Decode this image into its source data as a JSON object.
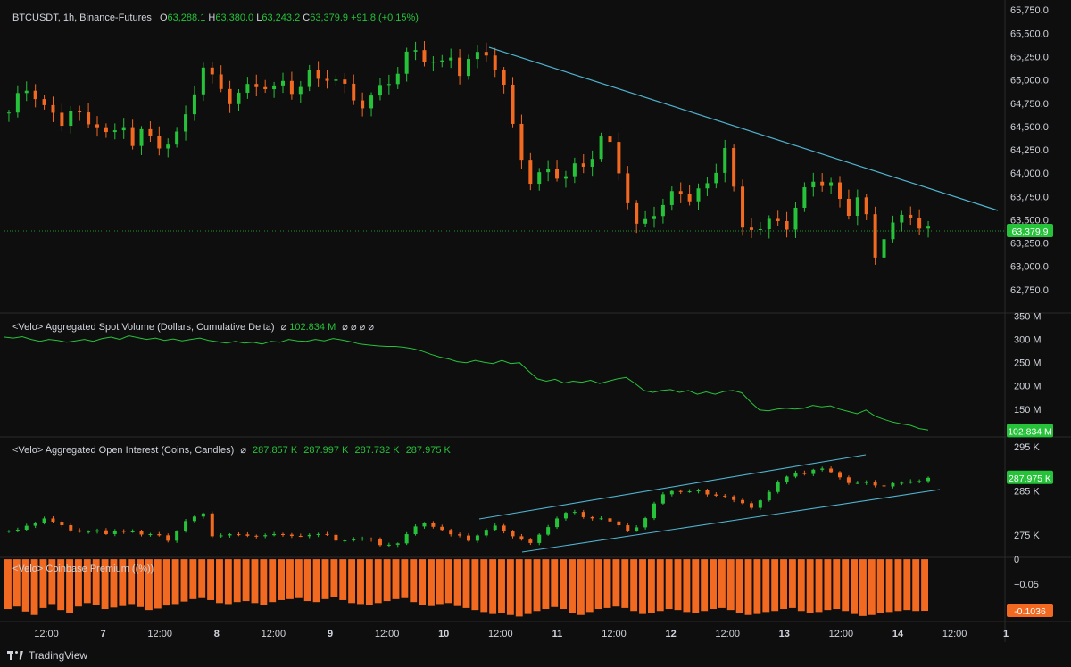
{
  "main": {
    "symbol": "BTCUSDT, 1h, Binance-Futures",
    "o_label": "O",
    "o_value": "63,288.1",
    "h_label": "H",
    "h_value": "63,380.0",
    "l_label": "L",
    "l_value": "63,243.2",
    "c_label": "C",
    "c_value": "63,379.9",
    "change": "+91.8 (+0.15%)",
    "last_price_tag": "63,379.9"
  },
  "volume_pane": {
    "title": "<Velo> Aggregated Spot Volume (Dollars, Cumulative Delta)",
    "settings_glyph": "⌀",
    "value": "102.834 M",
    "extra_glyphs": "⌀ ⌀ ⌀ ⌀",
    "tag": "102.834 M"
  },
  "oi_pane": {
    "title": "<Velo> Aggregated Open Interest (Coins, Candles)",
    "settings_glyph": "⌀",
    "values": [
      "287.857 K",
      "287.997 K",
      "287.732 K",
      "287.975 K"
    ],
    "tag": "287.975 K"
  },
  "premium_pane": {
    "title": "<Velo> Coinbase Premium ((%))",
    "tag": "-0.1036"
  },
  "footer": {
    "brand": "TradingView"
  },
  "colors": {
    "up": "#26c23a",
    "down": "#f26a21",
    "trend": "#4fb3cf",
    "line": "#26c23a",
    "bg": "#0e0e0e"
  },
  "chart_data": [
    {
      "type": "candlestick",
      "title": "BTCUSDT, 1h, Binance-Futures",
      "x_tick_labels": [
        "12:00",
        "7",
        "12:00",
        "8",
        "12:00",
        "9",
        "12:00",
        "10",
        "12:00",
        "11",
        "12:00",
        "12",
        "12:00",
        "13",
        "12:00",
        "14",
        "12:00",
        "1"
      ],
      "y_tick_labels": [
        "65,750.0",
        "65,500.0",
        "65,250.0",
        "65,000.0",
        "64,750.0",
        "64,500.0",
        "64,250.0",
        "64,000.0",
        "63,750.0",
        "63,500.0",
        "63,250.0",
        "63,000.0",
        "62,750.0"
      ],
      "ylim": [
        62500,
        65800
      ],
      "close_path_x": [
        0,
        10,
        20,
        30,
        40,
        50,
        60,
        70,
        80,
        90,
        100,
        110,
        120,
        130,
        140,
        150,
        160,
        170,
        180,
        190,
        200,
        210,
        220,
        230,
        240,
        250,
        260,
        270,
        280,
        290,
        300,
        310,
        320,
        330,
        340,
        350,
        360,
        370,
        380,
        390,
        400,
        410,
        420,
        430,
        440,
        450,
        460,
        470,
        480,
        490,
        500,
        510,
        520,
        530,
        540,
        550,
        560,
        570,
        580,
        590,
        600,
        610,
        620,
        630,
        640,
        650,
        660,
        670,
        680,
        690,
        700,
        710,
        720,
        730,
        740,
        750,
        760,
        770,
        780,
        790,
        800,
        810,
        820,
        830,
        840,
        850,
        860,
        870,
        880,
        890,
        900,
        910,
        920,
        930,
        940,
        950,
        960,
        970,
        980,
        990,
        1000,
        1010,
        1020,
        1030,
        1040
      ],
      "close_path_y": [
        64650,
        64800,
        64900,
        64850,
        64700,
        64600,
        64550,
        64700,
        64600,
        64500,
        64550,
        64450,
        64400,
        64500,
        64350,
        64450,
        64350,
        64300,
        64350,
        64400,
        64600,
        64900,
        65150,
        65000,
        64900,
        64800,
        64850,
        64900,
        64950,
        64950,
        64900,
        64950,
        64900,
        64950,
        65050,
        65000,
        65050,
        65000,
        64900,
        64800,
        64750,
        64800,
        64900,
        65000,
        65100,
        65250,
        65300,
        65250,
        65200,
        65150,
        65250,
        65100,
        65200,
        65250,
        65300,
        65150,
        64900,
        64500,
        64200,
        63900,
        63950,
        64050,
        64000,
        63950,
        64050,
        64100,
        64200,
        64350,
        64300,
        64050,
        63700,
        63400,
        63500,
        63600,
        63650,
        63750,
        63800,
        63750,
        63800,
        63850,
        64050,
        64300,
        63800,
        63400,
        63450,
        63400,
        63450,
        63500,
        63450,
        63600,
        63800,
        63950,
        63900,
        63850,
        63700,
        63600,
        63750,
        63500,
        63100,
        63350,
        63450,
        63500,
        63550,
        63450,
        63380
      ],
      "last_price": 63379.9,
      "trendline": {
        "from": [
          0,
          65350
        ],
        "to": [
          1,
          63600
        ]
      }
    },
    {
      "type": "line",
      "title": "<Velo> Aggregated Spot Volume (Dollars, Cumulative Delta)",
      "y_tick_labels": [
        "350 M",
        "300 M",
        "250 M",
        "200 M",
        "150 M"
      ],
      "ylim": [
        90,
        355
      ],
      "last_value": 102.834,
      "series": [
        {
          "values": [
            305,
            303,
            306,
            300,
            296,
            300,
            298,
            294,
            297,
            300,
            296,
            302,
            305,
            300,
            308,
            304,
            300,
            303,
            298,
            301,
            297,
            300,
            303,
            298,
            295,
            292,
            296,
            292,
            294,
            290,
            296,
            294,
            300,
            297,
            296,
            300,
            297,
            302,
            299,
            295,
            290,
            288,
            286,
            285,
            285,
            283,
            280,
            275,
            268,
            262,
            258,
            252,
            250,
            255,
            251,
            248,
            255,
            248,
            250,
            232,
            215,
            210,
            214,
            206,
            210,
            208,
            212,
            205,
            210,
            215,
            218,
            205,
            190,
            186,
            190,
            192,
            186,
            190,
            182,
            187,
            182,
            188,
            190,
            185,
            165,
            148,
            146,
            150,
            152,
            150,
            152,
            158,
            155,
            157,
            150,
            145,
            140,
            148,
            135,
            128,
            122,
            118,
            115,
            108,
            105
          ]
        }
      ]
    },
    {
      "type": "candlestick",
      "title": "<Velo> Aggregated Open Interest (Coins, Candles)",
      "y_tick_labels": [
        "295 K",
        "285 K",
        "275 K"
      ],
      "ylim": [
        270,
        297
      ],
      "last_value": 287.975,
      "close_path_x": [
        0,
        10,
        20,
        30,
        40,
        50,
        60,
        70,
        80,
        90,
        100,
        110,
        120,
        130,
        140,
        150,
        160,
        170,
        180,
        190,
        200,
        210,
        220,
        230,
        240,
        250,
        260,
        270,
        280,
        290,
        300,
        310,
        320,
        330,
        340,
        350,
        360,
        370,
        380,
        390,
        400,
        410,
        420,
        430,
        440,
        450,
        460,
        470,
        480,
        490,
        500,
        510,
        520,
        530,
        540,
        550,
        560,
        570,
        580,
        590,
        600,
        610,
        620,
        630,
        640,
        650,
        660,
        670,
        680,
        690,
        700,
        710,
        720,
        730,
        740,
        750,
        760,
        770,
        780,
        790,
        800,
        810,
        820,
        830,
        840,
        850,
        860,
        870,
        880,
        890,
        900,
        910,
        920,
        930,
        940,
        950,
        960,
        970,
        980,
        990,
        1000,
        1010,
        1020,
        1030,
        1040
      ],
      "close_path_y": [
        276,
        276,
        277,
        278,
        279,
        278,
        277,
        276,
        276,
        276,
        276,
        275,
        276,
        276,
        276,
        275,
        275,
        275,
        274,
        276,
        278,
        279,
        280,
        275,
        275,
        275,
        275,
        275,
        275,
        275,
        275,
        275,
        275,
        275,
        275,
        275,
        275,
        274,
        274,
        274,
        274,
        274,
        273,
        273,
        273,
        275,
        277,
        278,
        277,
        276,
        275,
        275,
        274,
        275,
        276,
        277,
        276,
        275,
        274,
        273,
        275,
        277,
        279,
        280,
        280,
        279,
        279,
        279,
        278,
        277,
        276,
        277,
        279,
        282,
        284,
        285,
        285,
        285,
        285,
        284,
        284,
        284,
        283,
        282,
        281,
        283,
        285,
        287,
        288,
        289,
        289,
        290,
        290,
        289,
        288,
        287,
        287,
        287,
        286,
        286,
        287,
        287,
        287,
        287,
        288
      ]
    },
    {
      "type": "bar",
      "title": "<Velo> Coinbase Premium ((%))",
      "y_tick_labels": [
        "0",
        "−0.05"
      ],
      "ylim": [
        -0.125,
        0.002
      ],
      "last_value": -0.1036,
      "values": [
        -0.1,
        -0.095,
        -0.105,
        -0.112,
        -0.098,
        -0.09,
        -0.102,
        -0.108,
        -0.095,
        -0.088,
        -0.092,
        -0.1,
        -0.097,
        -0.094,
        -0.09,
        -0.096,
        -0.102,
        -0.099,
        -0.093,
        -0.09,
        -0.085,
        -0.08,
        -0.078,
        -0.082,
        -0.088,
        -0.09,
        -0.086,
        -0.084,
        -0.088,
        -0.092,
        -0.086,
        -0.082,
        -0.08,
        -0.078,
        -0.084,
        -0.086,
        -0.08,
        -0.076,
        -0.082,
        -0.088,
        -0.09,
        -0.092,
        -0.088,
        -0.084,
        -0.08,
        -0.078,
        -0.086,
        -0.092,
        -0.094,
        -0.09,
        -0.088,
        -0.094,
        -0.098,
        -0.102,
        -0.106,
        -0.11,
        -0.108,
        -0.112,
        -0.115,
        -0.11,
        -0.104,
        -0.1,
        -0.096,
        -0.1,
        -0.108,
        -0.112,
        -0.106,
        -0.1,
        -0.098,
        -0.095,
        -0.098,
        -0.104,
        -0.11,
        -0.108,
        -0.104,
        -0.1,
        -0.102,
        -0.106,
        -0.108,
        -0.104,
        -0.1,
        -0.098,
        -0.102,
        -0.108,
        -0.112,
        -0.11,
        -0.106,
        -0.104,
        -0.1,
        -0.098,
        -0.104,
        -0.108,
        -0.106,
        -0.102,
        -0.1,
        -0.104,
        -0.11,
        -0.114,
        -0.112,
        -0.108,
        -0.106,
        -0.104,
        -0.102,
        -0.104,
        -0.1036
      ]
    }
  ]
}
